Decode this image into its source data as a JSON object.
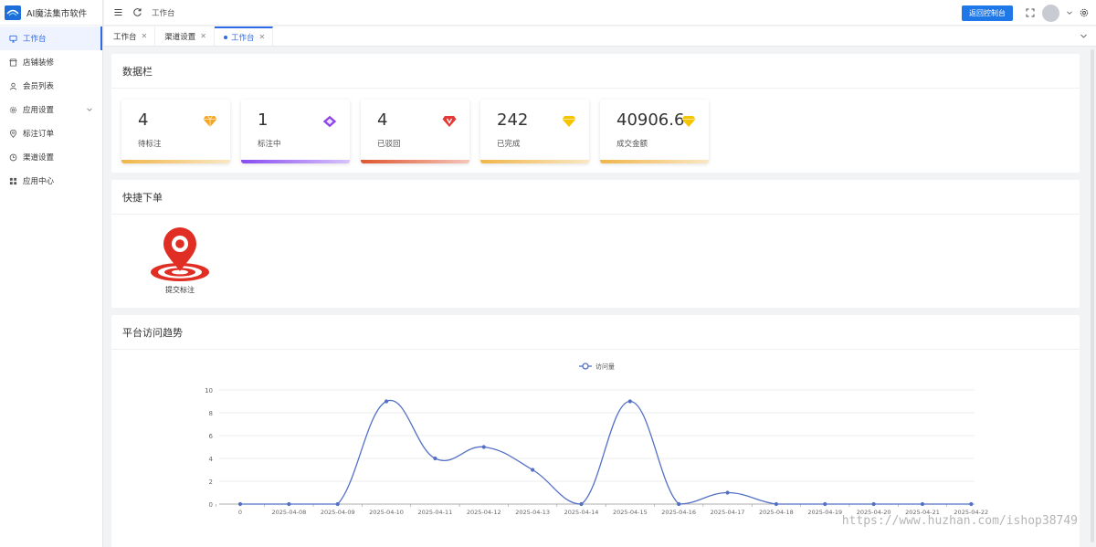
{
  "app": {
    "title": "AI魔法集市软件"
  },
  "sidebar": {
    "items": [
      {
        "label": "工作台",
        "icon": "monitor-icon",
        "active": true
      },
      {
        "label": "店铺装修",
        "icon": "store-icon"
      },
      {
        "label": "会员列表",
        "icon": "user-icon"
      },
      {
        "label": "应用设置",
        "icon": "settings-icon",
        "has_submenu": true
      },
      {
        "label": "标注订单",
        "icon": "location-icon"
      },
      {
        "label": "渠道设置",
        "icon": "clock-icon"
      },
      {
        "label": "应用中心",
        "icon": "grid-icon"
      }
    ]
  },
  "header": {
    "breadcrumb": "工作台",
    "back_button": "返回控制台"
  },
  "tabs": [
    {
      "label": "工作台",
      "active": false
    },
    {
      "label": "渠道设置",
      "active": false
    },
    {
      "label": "工作台",
      "active": true
    }
  ],
  "data_panel": {
    "title": "数据栏",
    "stats": [
      {
        "value": "4",
        "label": "待标注",
        "gem_color": "#f5a623",
        "bar_color": "#f0b64a"
      },
      {
        "value": "1",
        "label": "标注中",
        "gem_color": "#8e44e8",
        "bar_color": "#8a4cf0"
      },
      {
        "value": "4",
        "label": "已驳回",
        "gem_color": "#e53935",
        "bar_color": "#e0552f"
      },
      {
        "value": "242",
        "label": "已完成",
        "gem_color": "#f7c400",
        "bar_color": "#f0b64a"
      },
      {
        "value": "40906.6",
        "label": "成交金额",
        "gem_color": "#f7c400",
        "bar_color": "#f0b64a"
      }
    ]
  },
  "quick_order": {
    "title": "快捷下单",
    "items": [
      {
        "label": "提交标注",
        "icon": "map-pin-target-icon",
        "color": "#e02e24"
      }
    ]
  },
  "trend_panel": {
    "title": "平台访问趋势"
  },
  "chart_data": {
    "type": "line",
    "categories": [
      "0",
      "2025-04-08",
      "2025-04-09",
      "2025-04-10",
      "2025-04-11",
      "2025-04-12",
      "2025-04-13",
      "2025-04-14",
      "2025-04-15",
      "2025-04-16",
      "2025-04-17",
      "2025-04-18",
      "2025-04-19",
      "2025-04-20",
      "2025-04-21",
      "2025-04-22"
    ],
    "series": [
      {
        "name": "访问量",
        "values": [
          0,
          0,
          0,
          9,
          4,
          5,
          3,
          0,
          9,
          0,
          1,
          0,
          0,
          0,
          0,
          0
        ],
        "color": "#5470c6"
      }
    ],
    "y_ticks": [
      "0",
      "2",
      "4",
      "6",
      "8",
      "10"
    ],
    "ylim": [
      0,
      10
    ],
    "smooth": true,
    "grid": true,
    "legend": "top-center"
  },
  "watermark": "https://www.huzhan.com/ishop38749"
}
